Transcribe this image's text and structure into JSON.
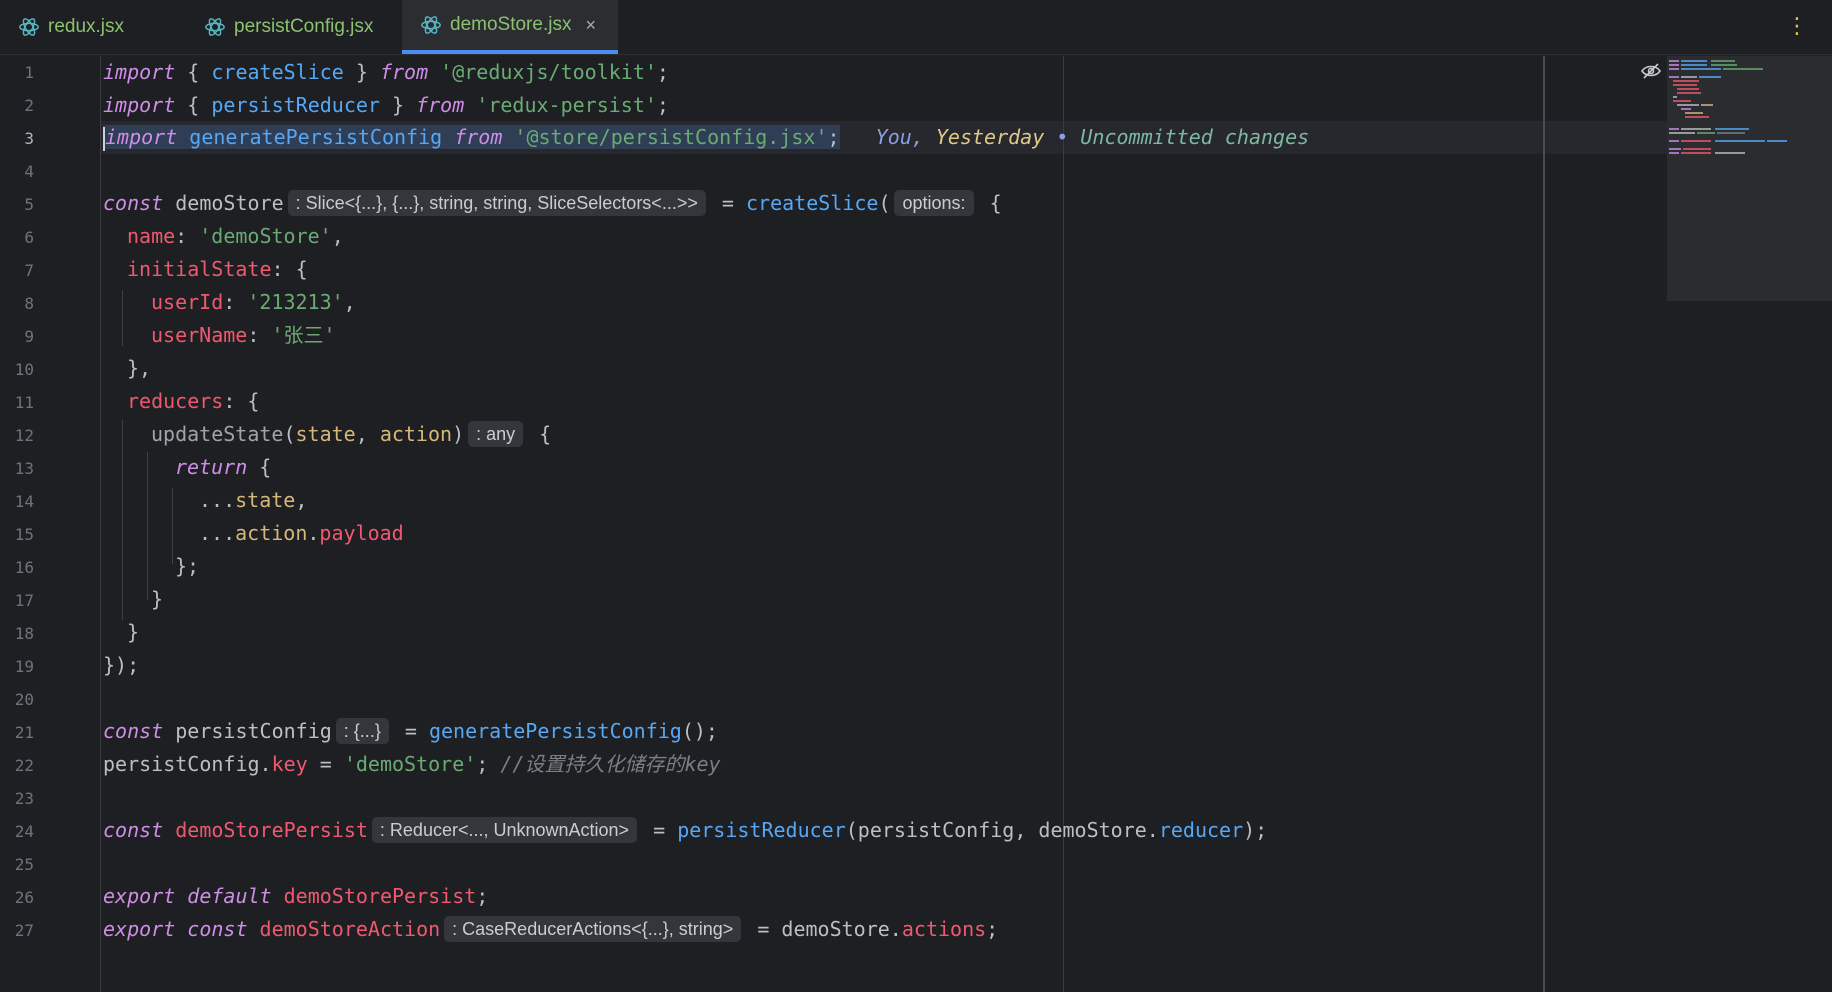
{
  "tabs": [
    {
      "label": "redux.jsx",
      "active": false
    },
    {
      "label": "persistConfig.jsx",
      "active": false
    },
    {
      "label": "demoStore.jsx",
      "active": true
    }
  ],
  "tab_close_glyph": "×",
  "more_glyph": "⋮",
  "line_numbers": [
    "1",
    "2",
    "3",
    "4",
    "5",
    "6",
    "7",
    "8",
    "9",
    "10",
    "11",
    "12",
    "13",
    "14",
    "15",
    "16",
    "17",
    "18",
    "19",
    "20",
    "21",
    "22",
    "23",
    "24",
    "25",
    "26",
    "27"
  ],
  "current_line": "3",
  "code": {
    "l1": [
      "import",
      "{ ",
      "createSlice",
      " } ",
      "from",
      " '@reduxjs/toolkit'",
      ";"
    ],
    "l2": [
      "import",
      "{ ",
      "persistReducer",
      " } ",
      "from",
      " 'redux-persist'",
      ";"
    ],
    "l3": [
      "import",
      " generatePersistConfig ",
      "from",
      " '@store/persistConfig.jsx'",
      ";"
    ],
    "l3_blame": {
      "who": "You, ",
      "when": "Yesterday",
      " sep": " • ",
      "what": "Uncommitted changes"
    },
    "l5": [
      "const",
      " demoStore",
      ": Slice<{...}, {...}, string, string, SliceSelectors<...>>",
      " = ",
      "createSlice",
      "(",
      "options:",
      " {"
    ],
    "l6": [
      "name",
      ": ",
      "'demoStore'",
      ","
    ],
    "l7": [
      "initialState",
      ": {"
    ],
    "l8": [
      "userId",
      ": ",
      "'213213'",
      ","
    ],
    "l9": [
      "userName",
      ": ",
      "'张三'"
    ],
    "l10": "},",
    "l11": [
      "reducers",
      ": {"
    ],
    "l12": [
      "updateState",
      "(",
      "state",
      ", ",
      "action",
      ")",
      ": any",
      " {"
    ],
    "l13": [
      "return",
      " {"
    ],
    "l14": [
      "...",
      "state",
      ","
    ],
    "l15": [
      "...",
      "action",
      ".",
      "payload"
    ],
    "l16": "};",
    "l17": "}",
    "l18": "}",
    "l19": "});",
    "l21": [
      "const",
      " persistConfig",
      ": {...}",
      " = ",
      "generatePersistConfig",
      "();"
    ],
    "l22": [
      "persistConfig",
      ".",
      "key",
      " = ",
      "'demoStore'",
      "; ",
      "//设置持久化储存的key"
    ],
    "l24": [
      "const",
      " demoStorePersist",
      ": Reducer<..., UnknownAction>",
      " = ",
      "persistReducer",
      "(persistConfig, demoStore.",
      "reducer",
      ");"
    ],
    "l26": [
      "export",
      " default",
      " demoStorePersist",
      ";"
    ],
    "l27": [
      "export",
      " const",
      " demoStoreAction",
      ": CaseReducerActions<{...}, string>",
      " = demoStore.",
      "actions",
      ";"
    ]
  },
  "colors": {
    "keyword": "#cf8ee6",
    "function": "#56a8f5",
    "string": "#6aab73",
    "property": "#ef596f",
    "param": "#d5b778",
    "accent": "#4a8cf0"
  }
}
